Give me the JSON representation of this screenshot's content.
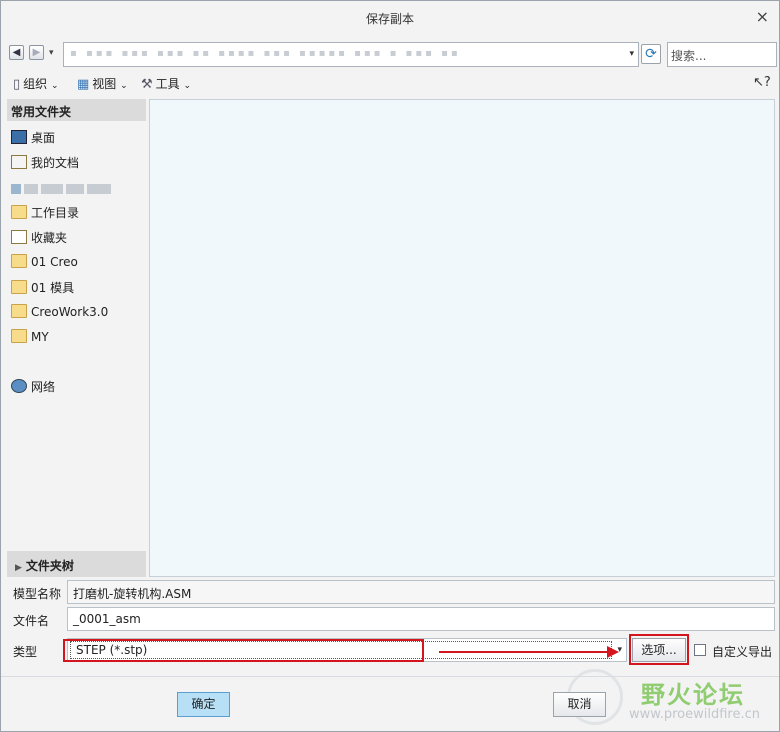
{
  "window": {
    "title": "保存副本",
    "close_symbol": "×"
  },
  "nav": {
    "back_symbol": "◀",
    "forward_symbol": "▶",
    "dropdown_symbol": "▾",
    "address_placeholder_text": "▪ ▪▪▪ ▪▪▪ ▪▪▪ ▪▪ ▪▪▪▪ ▪▪▪ ▪▪▪▪▪ ▪▪▪ ▪ ▪▪▪ ▪▪",
    "refresh_symbol": "⟳",
    "search_placeholder": "搜索..."
  },
  "toolbar": {
    "organize_label": "组织",
    "view_label": "视图",
    "tools_label": "工具",
    "help_symbol": "↖?"
  },
  "sidebar": {
    "header": "常用文件夹",
    "items": [
      {
        "label": "桌面",
        "icon": "desktop-icon"
      },
      {
        "label": "我的文档",
        "icon": "documents-icon"
      },
      {
        "label": "工作目录",
        "icon": "work-folder-icon"
      },
      {
        "label": "收藏夹",
        "icon": "favorites-icon"
      },
      {
        "label": "01 Creo",
        "icon": "folder-icon"
      },
      {
        "label": "01 模具",
        "icon": "folder-icon"
      },
      {
        "label": "CreoWork3.0",
        "icon": "folder-icon"
      },
      {
        "label": "MY",
        "icon": "folder-icon"
      },
      {
        "label": "网络",
        "icon": "network-icon"
      }
    ],
    "footer": "文件夹树"
  },
  "form": {
    "model_name_label": "模型名称",
    "model_name_value": "打磨机-旋转机构.ASM",
    "file_name_label": "文件名",
    "file_name_value": "_0001_asm",
    "type_label": "类型",
    "type_value": "STEP (*.stp)",
    "options_label": "选项...",
    "custom_export_label": "自定义导出",
    "custom_export_checked": false
  },
  "buttons": {
    "ok_label": "确定",
    "cancel_label": "取消"
  },
  "watermark": {
    "text": "野火论坛",
    "url": "www.proewildfire.cn"
  },
  "colors": {
    "highlight_red": "#d3161e",
    "ok_blue": "#b7e0f6",
    "content_bg": "#f0f8fc"
  }
}
